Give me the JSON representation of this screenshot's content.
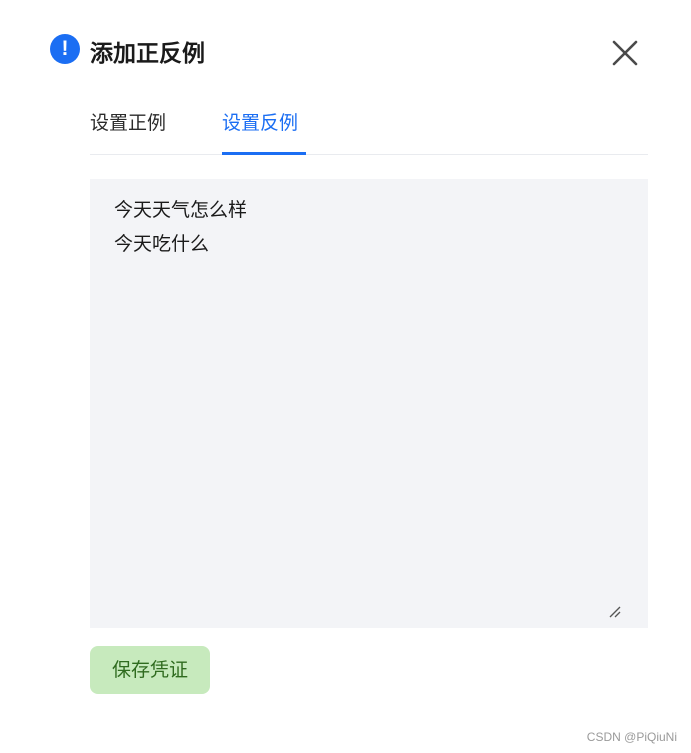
{
  "dialog": {
    "title": "添加正反例",
    "alert_icon_glyph": "!",
    "icons": {
      "alert": "exclamation-circle-icon",
      "close": "close-icon",
      "resize": "resize-handle-icon"
    },
    "colors": {
      "accent": "#1b6ef3",
      "textarea_bg": "#f3f4f7",
      "save_bg": "#c7eabd",
      "save_text": "#2f6b1f"
    }
  },
  "tabs": [
    {
      "label": "设置正例",
      "active": false
    },
    {
      "label": "设置反例",
      "active": true
    }
  ],
  "editor": {
    "value": "今天天气怎么样\n今天吃什么"
  },
  "actions": {
    "save_label": "保存凭证"
  },
  "watermark": "CSDN @PiQiuNi"
}
